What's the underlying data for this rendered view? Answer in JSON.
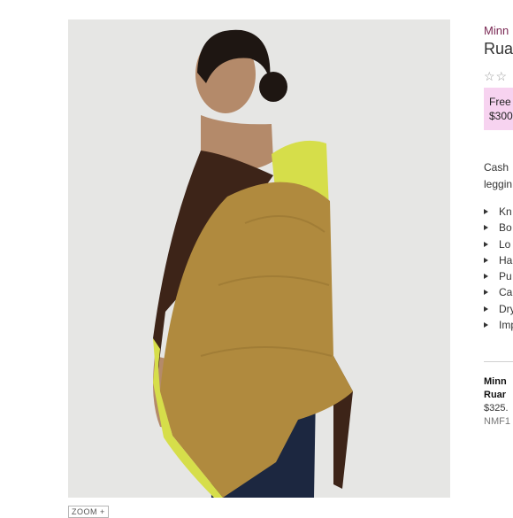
{
  "product": {
    "brand": "Minn",
    "title": "Ruar",
    "rating_stars": "☆☆",
    "promo_line1": "Free",
    "promo_line2": "$300",
    "description_line1": "Cash",
    "description_line2": "leggin",
    "features": [
      "Kn",
      "Bo",
      "Lo",
      "Ha",
      "Pu",
      "Ca",
      "Dry",
      "Imp"
    ]
  },
  "image": {
    "alt": "poncho-model-photo",
    "colors": {
      "background": "#e6e6e4",
      "camel": "#b08a3e",
      "brown": "#3d2418",
      "chartreuse": "#d6de4a",
      "skin": "#b48a6a",
      "hair": "#1e1612",
      "jeans": "#1c2740"
    }
  },
  "zoom": {
    "label": "ZOOM +"
  },
  "related": {
    "brand": "Minn",
    "name": "Ruar",
    "price": "$325.",
    "sku": "NMF1"
  },
  "colors": {
    "brand_accent": "#7b2a55",
    "promo_background": "#f7d3f0"
  }
}
